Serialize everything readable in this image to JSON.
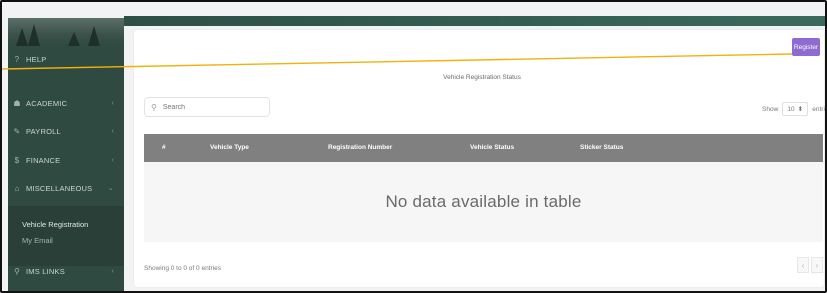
{
  "sidebar": {
    "items": [
      {
        "icon": "help-icon",
        "glyph": "?",
        "label": "HELP"
      },
      {
        "icon": "academic-icon",
        "glyph": "☗",
        "label": "ACADEMIC"
      },
      {
        "icon": "payroll-icon",
        "glyph": "✎",
        "label": "PAYROLL"
      },
      {
        "icon": "finance-icon",
        "glyph": "$",
        "label": "FINANCE"
      },
      {
        "icon": "miscellaneous-icon",
        "glyph": "⌂",
        "label": "MISCELLANEOUS"
      }
    ],
    "subitems": [
      {
        "label": "Vehicle Registration"
      },
      {
        "label": "My Email"
      }
    ],
    "bottom_item": {
      "icon": "links-icon",
      "glyph": "⚲",
      "label": "IMS LINKS"
    }
  },
  "header": {
    "register_label": "Register",
    "title": "Vehicle Registration Status"
  },
  "search": {
    "placeholder": "Search"
  },
  "show": {
    "label": "Show",
    "value": "10",
    "suffix": "entries"
  },
  "table": {
    "columns": [
      "#",
      "Vehicle Type",
      "Registration Number",
      "Vehicle Status",
      "Sticker Status"
    ],
    "empty_message": "No data available in table"
  },
  "footer": {
    "info": "Showing 0 to 0 of 0 entries",
    "prev": "‹",
    "next": "›"
  },
  "colors": {
    "sidebar": "#2f4a40",
    "register_button": "#8e6bd0",
    "table_header": "#808080",
    "annotation_line": "#f2b10c"
  }
}
